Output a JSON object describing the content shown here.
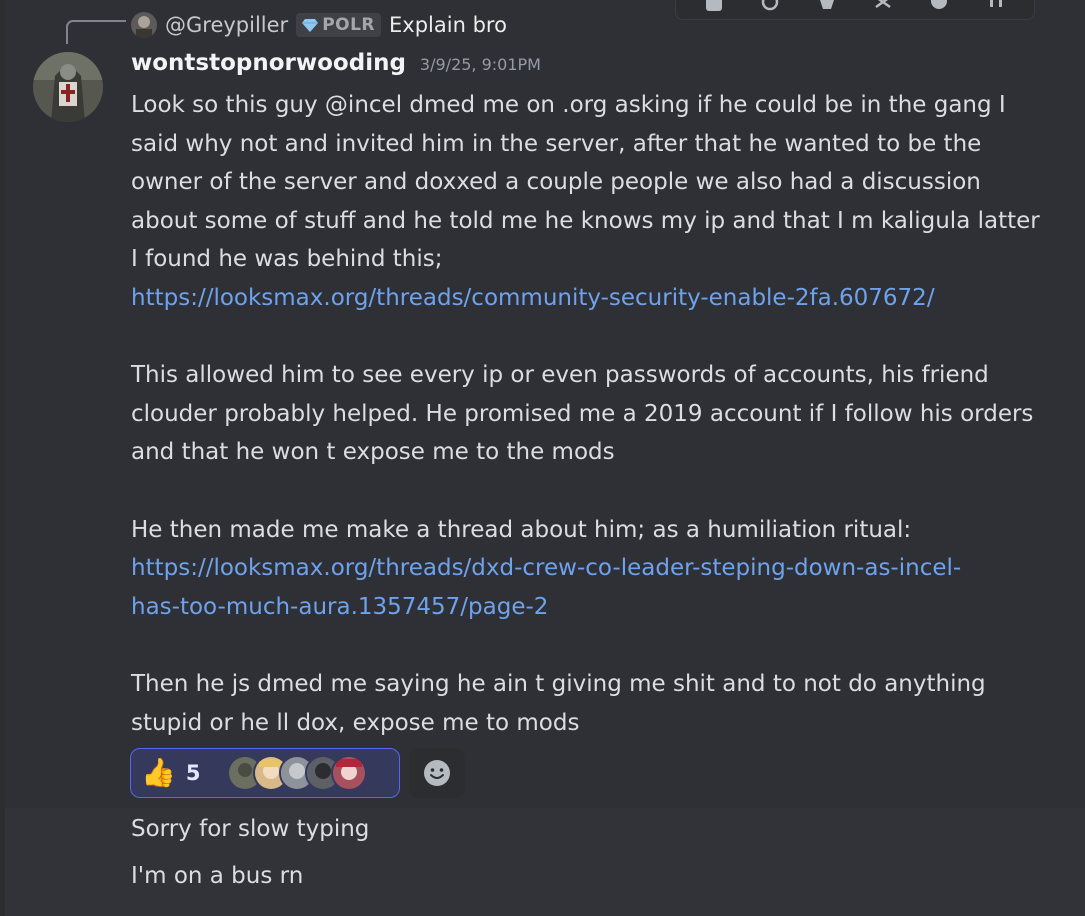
{
  "reply": {
    "username": "@Greypiller",
    "role": "POLR",
    "text": "Explain bro"
  },
  "message": {
    "username": "wontstopnorwooding",
    "timestamp": "3/9/25, 9:01PM",
    "paragraphs": [
      {
        "lines": [
          "Look so this guy @incel dmed me on .org asking if he could be in the gang I",
          "said why not and invited him in the server, after that he wanted to be the",
          "owner of the server and doxxed a couple people we also had a discussion",
          "about some of stuff and he told me he knows my ip and that I m kaligula latter",
          "I found he was behind this;"
        ],
        "link_lines": [
          "https://looksmax.org/threads/community-security-enable-2fa.607672/"
        ]
      },
      {
        "lines": [
          "This allowed him to see every ip or even passwords of accounts, his friend",
          "clouder probably helped. He promised me a 2019 account if I follow his orders",
          "and that he won t expose me to the mods"
        ],
        "link_lines": []
      },
      {
        "lines": [
          "He then made me make a thread about him; as a humiliation ritual:"
        ],
        "link_lines": [
          "https://looksmax.org/threads/dxd-crew-co-leader-steping-down-as-incel-",
          "has-too-much-aura.1357457/page-2"
        ]
      },
      {
        "lines": [
          "Then he js dmed me saying he ain t giving me shit and to not do anything",
          "stupid or he ll dox, expose me to mods"
        ],
        "link_lines": []
      }
    ]
  },
  "reaction": {
    "emoji": "👍",
    "count": "5",
    "reactor_colors": [
      "#6b6f60",
      "#d9b98a",
      "#8d939a",
      "#5d6066",
      "#a8515e"
    ]
  },
  "followups": [
    "Sorry for slow typing",
    "I'm on a bus rn"
  ],
  "colors": {
    "link": "#6ea2ec",
    "reaction_border": "#5865f2"
  }
}
